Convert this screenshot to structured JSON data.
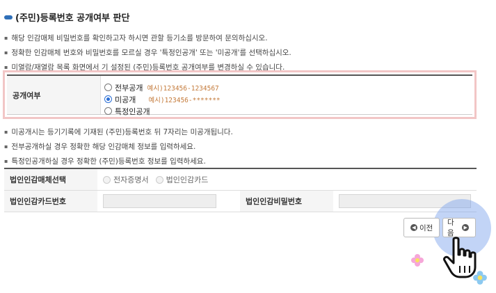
{
  "page": {
    "title": "(주민)등록번호 공개여부 판단"
  },
  "notes_top": [
    "해당 인감매체 비밀번호를 확인하고자 하시면 관할 등기소를 방문하여 문의하십시오.",
    "정확한 인감매체 번호와 비밀번호를 모르실 경우 '특정인공개' 또는 '미공개'를 선택하십시오.",
    "미열람/재열람 목록 화면에서 기 설정된 (주민)등록번호 공개여부를 변경하실 수 있습니다."
  ],
  "disclosure": {
    "label": "공개여부",
    "options": [
      {
        "label": "전부공개",
        "example": "예시)123456-1234567",
        "checked": false
      },
      {
        "label": "미공개",
        "example": "예시)123456-*******",
        "checked": true
      },
      {
        "label": "특정인공개",
        "example": "",
        "checked": false
      }
    ]
  },
  "notes_bottom": [
    "미공개시는 등기기록에 기재된 (주민)등록번호 뒤 7자리는 미공개됩니다.",
    "전부공개하실 경우 정확한 해당 인감매체 정보를 입력하세요.",
    "특정인공개하실 경우 정확한 (주민)등록번호 정보를 입력하세요."
  ],
  "cert_table": {
    "medium_label": "법인인감매체선택",
    "medium_options": [
      "전자증명서",
      "법인인감카드"
    ],
    "card_number_label": "법인인감카드번호",
    "card_number_value": "",
    "password_label": "법인인감비밀번호",
    "password_value": ""
  },
  "buttons": {
    "prev_label": "이전",
    "next_label": "다음"
  },
  "colors": {
    "accent": "#2f6fb8",
    "highlight_border": "#f2c6c6",
    "example_text": "#c47a3a",
    "click_halo": "#78a0eb"
  }
}
